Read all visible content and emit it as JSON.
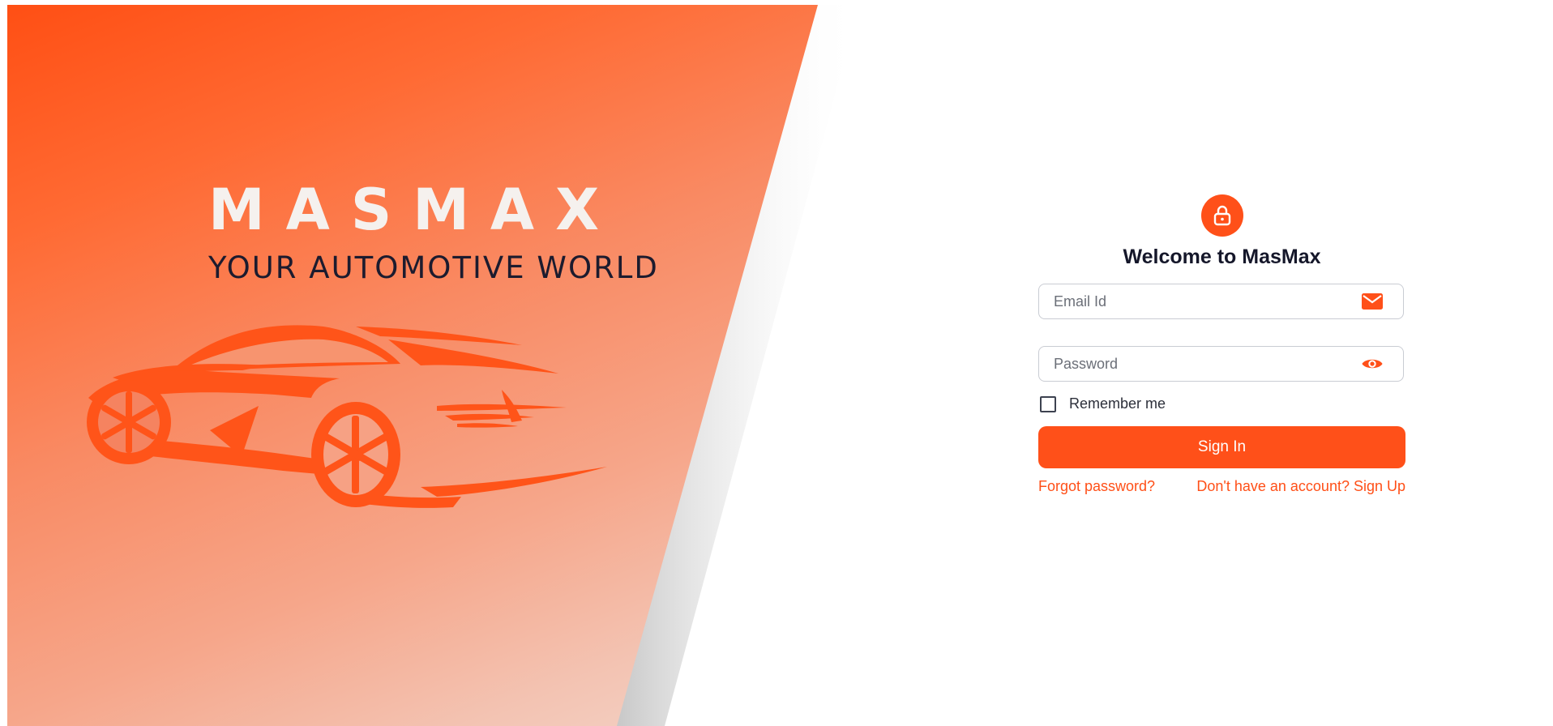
{
  "hero": {
    "brand": "MASMAX",
    "tagline": "YOUR AUTOMOTIVE WORLD",
    "car_illustration": "car-silhouette-icon"
  },
  "login": {
    "lock_icon": "lock-icon",
    "title": "Welcome to MasMax",
    "email": {
      "placeholder": "Email Id",
      "value": "",
      "icon": "mail-icon"
    },
    "password": {
      "placeholder": "Password",
      "value": "",
      "icon": "eye-icon"
    },
    "remember_me": {
      "label": "Remember me",
      "checked": false
    },
    "signin_label": "Sign In",
    "forgot_label": "Forgot password?",
    "signup_label": "Don't have an account? Sign Up"
  },
  "colors": {
    "accent": "#ff5019",
    "title_text": "#15172a",
    "brand_text": "#f5f1ee",
    "tagline_text": "#1c1b2e"
  }
}
